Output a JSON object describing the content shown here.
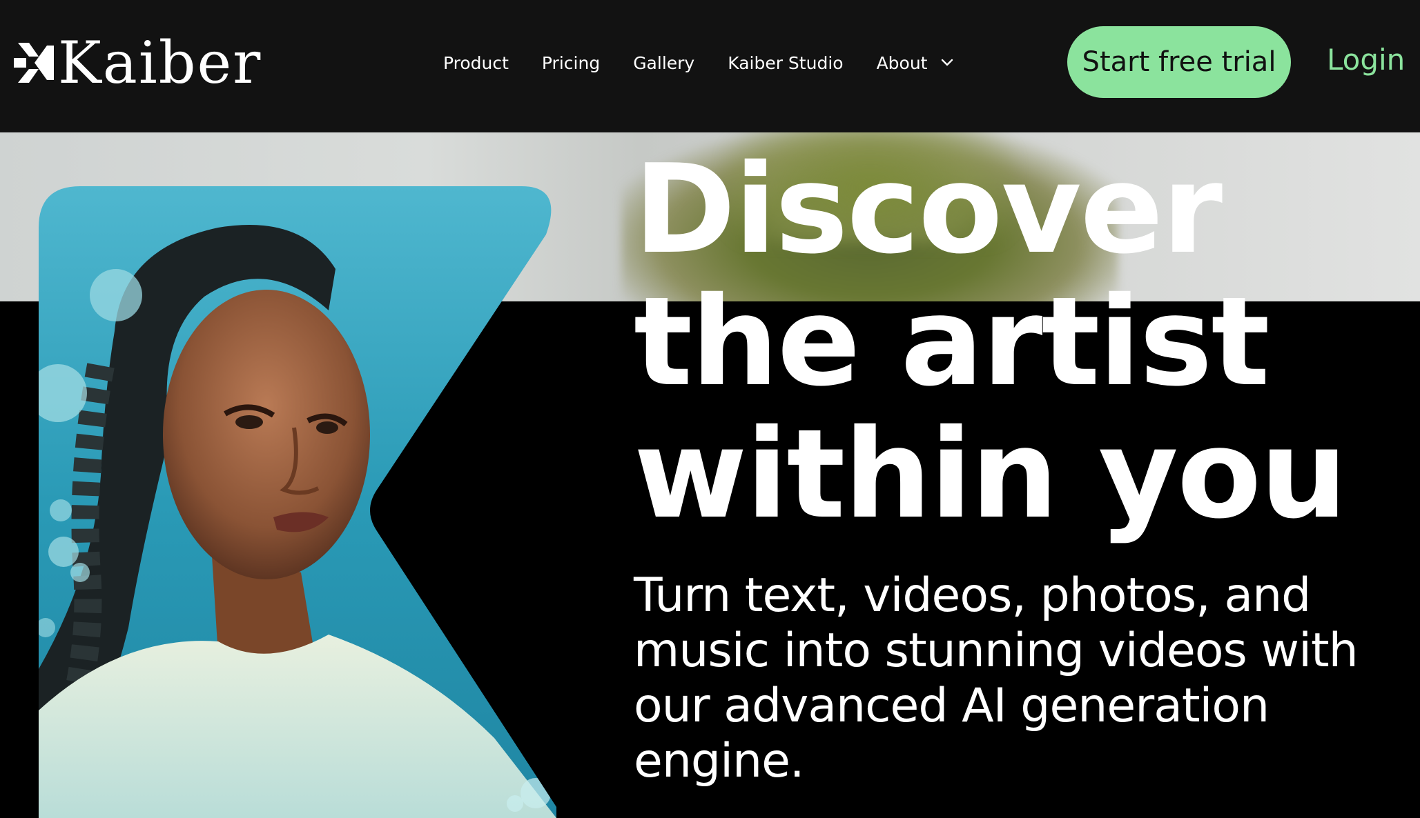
{
  "nav": {
    "logo_text": "Kaiber",
    "items": [
      {
        "label": "Product"
      },
      {
        "label": "Pricing"
      },
      {
        "label": "Gallery"
      },
      {
        "label": "Kaiber Studio"
      },
      {
        "label": "About"
      }
    ],
    "cta_label": "Start free trial",
    "login_label": "Login"
  },
  "hero": {
    "headline_lines": [
      "Discover",
      "the artist",
      "within you"
    ],
    "subcopy": "Turn text, videos, photos, and music into stunning videos with our advanced AI generation engine.",
    "image_alt": "AI-generated portrait of a woman underwater with braided hair and bubbles"
  },
  "colors": {
    "accent": "#8be39d",
    "nav_bg": "#121212",
    "page_bg": "#000000",
    "portrait_water": "#2b9bb5"
  }
}
